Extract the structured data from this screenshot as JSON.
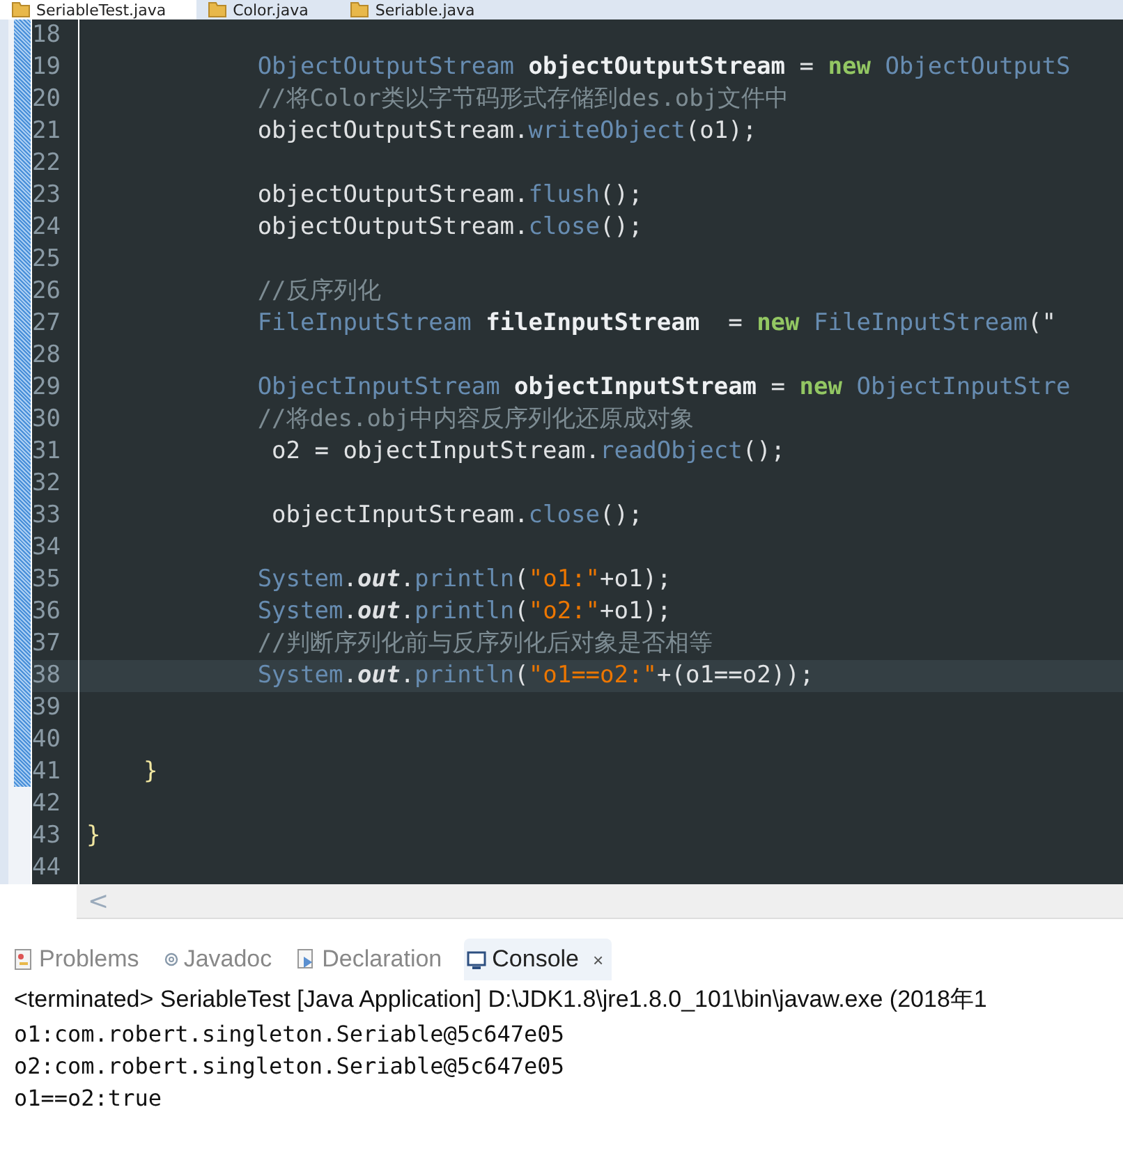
{
  "editor_tabs": [
    {
      "label": "SeriableTest.java",
      "selected": true
    },
    {
      "label": "Color.java",
      "selected": false
    },
    {
      "label": "Seriable.java",
      "selected": false
    }
  ],
  "code_lines": [
    {
      "number": "18",
      "selected": false
    },
    {
      "number": "19",
      "selected": false,
      "tokens": [
        {
          "kind": "type",
          "text": "            ObjectOutputStream "
        },
        {
          "kind": "var",
          "text": "objectOutputStream"
        },
        {
          "kind": "plain",
          "text": " = "
        },
        {
          "kind": "keyword",
          "text": "new"
        },
        {
          "kind": "type",
          "text": " ObjectOutputS"
        }
      ]
    },
    {
      "number": "20",
      "selected": false,
      "tokens": [
        {
          "kind": "comment",
          "text": "            //将Color类以字节码形式存储到des.obj文件中"
        }
      ]
    },
    {
      "number": "21",
      "selected": false,
      "tokens": [
        {
          "kind": "plain",
          "text": "            objectOutputStream."
        },
        {
          "kind": "method",
          "text": "writeObject"
        },
        {
          "kind": "plain",
          "text": "(o1);"
        }
      ]
    },
    {
      "number": "22",
      "selected": false
    },
    {
      "number": "23",
      "selected": false,
      "tokens": [
        {
          "kind": "plain",
          "text": "            objectOutputStream."
        },
        {
          "kind": "method",
          "text": "flush"
        },
        {
          "kind": "plain",
          "text": "();"
        }
      ]
    },
    {
      "number": "24",
      "selected": false,
      "tokens": [
        {
          "kind": "plain",
          "text": "            objectOutputStream."
        },
        {
          "kind": "method",
          "text": "close"
        },
        {
          "kind": "plain",
          "text": "();"
        }
      ]
    },
    {
      "number": "25",
      "selected": false
    },
    {
      "number": "26",
      "selected": false,
      "tokens": [
        {
          "kind": "comment",
          "text": "            //反序列化"
        }
      ]
    },
    {
      "number": "27",
      "selected": false,
      "tokens": [
        {
          "kind": "type",
          "text": "            FileInputStream "
        },
        {
          "kind": "var",
          "text": "fileInputStream"
        },
        {
          "kind": "plain",
          "text": "  = "
        },
        {
          "kind": "keyword",
          "text": "new"
        },
        {
          "kind": "type",
          "text": " FileInputStream"
        },
        {
          "kind": "plain",
          "text": "(\""
        }
      ]
    },
    {
      "number": "28",
      "selected": false
    },
    {
      "number": "29",
      "selected": false,
      "tokens": [
        {
          "kind": "type",
          "text": "            ObjectInputStream "
        },
        {
          "kind": "var",
          "text": "objectInputStream"
        },
        {
          "kind": "plain",
          "text": " = "
        },
        {
          "kind": "keyword",
          "text": "new"
        },
        {
          "kind": "type",
          "text": " ObjectInputStre"
        }
      ]
    },
    {
      "number": "30",
      "selected": false,
      "tokens": [
        {
          "kind": "comment",
          "text": "            //将des.obj中内容反序列化还原成对象"
        }
      ]
    },
    {
      "number": "31",
      "selected": false,
      "tokens": [
        {
          "kind": "plain",
          "text": "             o2 = objectInputStream."
        },
        {
          "kind": "method",
          "text": "readObject"
        },
        {
          "kind": "plain",
          "text": "();"
        }
      ]
    },
    {
      "number": "32",
      "selected": false
    },
    {
      "number": "33",
      "selected": false,
      "tokens": [
        {
          "kind": "plain",
          "text": "             objectInputStream."
        },
        {
          "kind": "method",
          "text": "close"
        },
        {
          "kind": "plain",
          "text": "();"
        }
      ]
    },
    {
      "number": "34",
      "selected": false
    },
    {
      "number": "35",
      "selected": false,
      "tokens": [
        {
          "kind": "type",
          "text": "            System"
        },
        {
          "kind": "plain",
          "text": "."
        },
        {
          "kind": "static",
          "text": "out"
        },
        {
          "kind": "plain",
          "text": "."
        },
        {
          "kind": "method",
          "text": "println"
        },
        {
          "kind": "plain",
          "text": "("
        },
        {
          "kind": "string",
          "text": "\"o1:\""
        },
        {
          "kind": "plain",
          "text": "+o1);"
        }
      ]
    },
    {
      "number": "36",
      "selected": false,
      "tokens": [
        {
          "kind": "type",
          "text": "            System"
        },
        {
          "kind": "plain",
          "text": "."
        },
        {
          "kind": "static",
          "text": "out"
        },
        {
          "kind": "plain",
          "text": "."
        },
        {
          "kind": "method",
          "text": "println"
        },
        {
          "kind": "plain",
          "text": "("
        },
        {
          "kind": "string",
          "text": "\"o2:\""
        },
        {
          "kind": "plain",
          "text": "+o1);"
        }
      ]
    },
    {
      "number": "37",
      "selected": false,
      "tokens": [
        {
          "kind": "comment",
          "text": "            //判断序列化前与反序列化后对象是否相等"
        }
      ]
    },
    {
      "number": "38",
      "selected": true,
      "tokens": [
        {
          "kind": "type",
          "text": "            System"
        },
        {
          "kind": "plain",
          "text": "."
        },
        {
          "kind": "static",
          "text": "out"
        },
        {
          "kind": "plain",
          "text": "."
        },
        {
          "kind": "method",
          "text": "println"
        },
        {
          "kind": "plain",
          "text": "("
        },
        {
          "kind": "string",
          "text": "\"o1==o2:\""
        },
        {
          "kind": "plain",
          "text": "+(o1==o2));"
        }
      ]
    },
    {
      "number": "39",
      "selected": false
    },
    {
      "number": "40",
      "selected": false
    },
    {
      "number": "41",
      "selected": false,
      "tokens": [
        {
          "kind": "brace",
          "text": "    }"
        }
      ]
    },
    {
      "number": "42",
      "selected": false
    },
    {
      "number": "43",
      "selected": false,
      "tokens": [
        {
          "kind": "brace",
          "text": "}"
        }
      ]
    },
    {
      "number": "44",
      "selected": false
    }
  ],
  "scroll_left": "<",
  "panel_tabs": [
    {
      "label": "Problems",
      "selected": false
    },
    {
      "label": "Javadoc",
      "selected": false
    },
    {
      "label": "Declaration",
      "selected": false
    },
    {
      "label": "Console",
      "selected": true,
      "close": "×"
    }
  ],
  "console": {
    "header": "<terminated> SeriableTest [Java Application] D:\\JDK1.8\\jre1.8.0_101\\bin\\javaw.exe (2018年1",
    "lines": [
      "o1:com.robert.singleton.Seriable@5c647e05",
      "o2:com.robert.singleton.Seriable@5c647e05",
      "o1==o2:true"
    ]
  }
}
